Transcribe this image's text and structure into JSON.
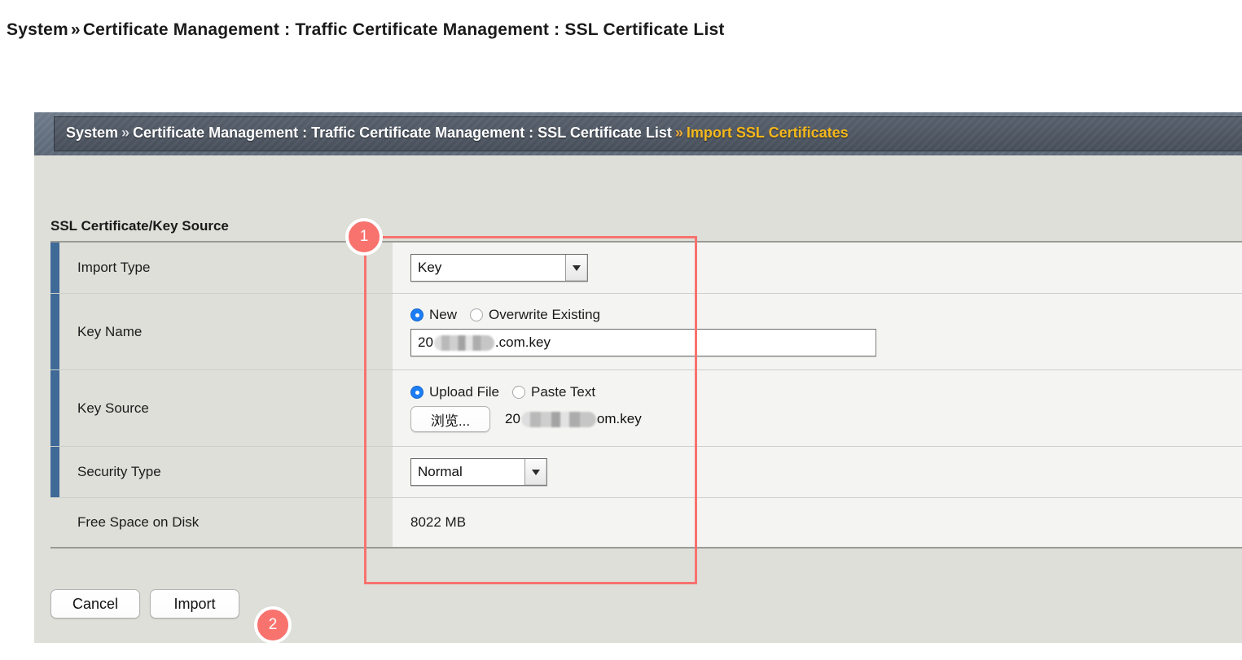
{
  "page": {
    "heading_prefix": "System",
    "heading_separator": "»",
    "heading_rest": "Certificate Management : Traffic Certificate Management : SSL Certificate List"
  },
  "panel": {
    "breadcrumb": {
      "root": "System",
      "sep_root": "»",
      "path": "Certificate Management : Traffic Certificate Management : SSL Certificate List",
      "sep_current": "»",
      "current": "Import SSL Certificates"
    },
    "section_title": "SSL Certificate/Key Source",
    "rows": [
      {
        "label": "Import Type",
        "type": "select",
        "value": "Key"
      },
      {
        "label": "Key Name",
        "type": "radio-text",
        "radios": [
          {
            "label": "New",
            "selected": true
          },
          {
            "label": "Overwrite Existing",
            "selected": false
          }
        ],
        "text_prefix": "20",
        "text_suffix": ".com.key"
      },
      {
        "label": "Key Source",
        "type": "radio-file",
        "radios": [
          {
            "label": "Upload File",
            "selected": true
          },
          {
            "label": "Paste Text",
            "selected": false
          }
        ],
        "browse_label": "浏览...",
        "file_prefix": "20",
        "file_suffix": "om.key"
      },
      {
        "label": "Security Type",
        "type": "select",
        "value": "Normal"
      },
      {
        "label": "Free Space on Disk",
        "type": "text",
        "value": "8022 MB"
      }
    ],
    "footer": {
      "cancel_label": "Cancel",
      "import_label": "Import"
    }
  },
  "annotations": {
    "badge_1": "1",
    "badge_2": "2",
    "accent_color": "#f8726e",
    "row_accent_color": "#3f6997",
    "radio_on_color": "#1d7df4",
    "breadcrumb_current_color": "#f5b81c"
  }
}
